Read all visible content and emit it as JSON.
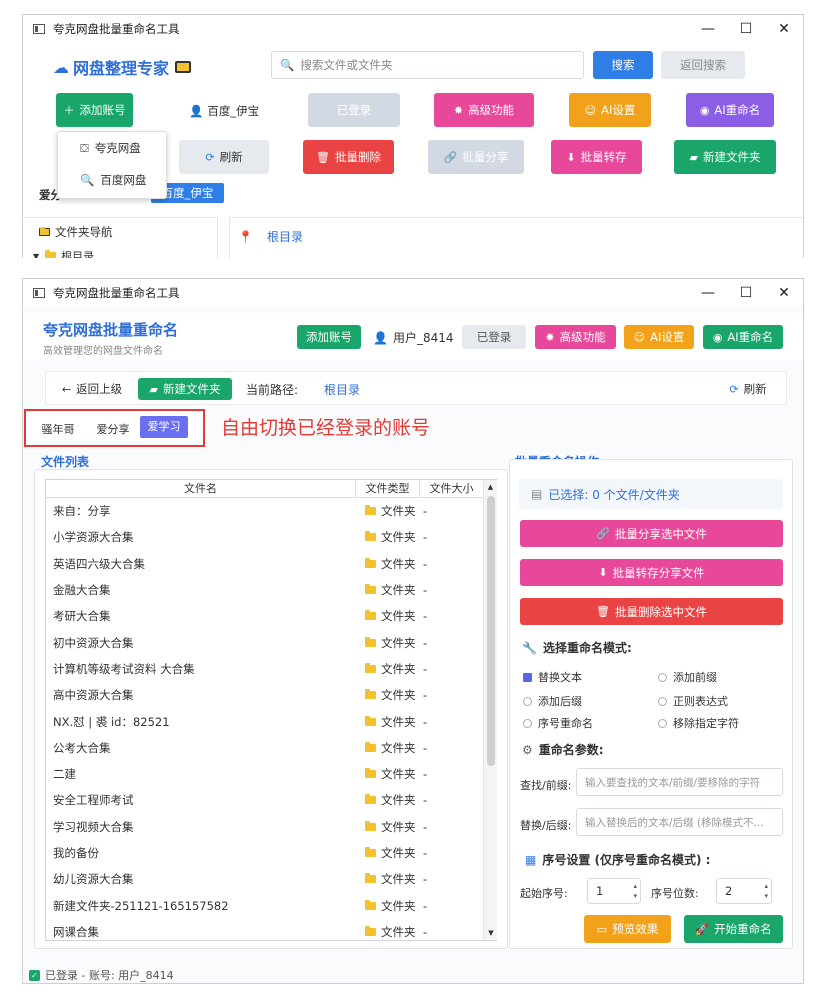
{
  "top_window": {
    "title": "夸克网盘批量重命名工具",
    "controls": [
      "—",
      "☐",
      "✕"
    ],
    "brand": "网盘整理专家",
    "search_placeholder": "搜索文件或文件夹",
    "search_btn": "搜索",
    "back_search_btn": "返回搜索",
    "add_account_btn": "添加账号",
    "user": "百度_伊宝",
    "logged_in_btn": "已登录",
    "advanced_btn": "高级功能",
    "ai_settings_btn": "AI设置",
    "ai_rename_btn": "AI重命名",
    "refresh_btn": "刷新",
    "batch_delete_btn": "批量删除",
    "batch_share_btn": "批量分享",
    "batch_save_btn": "批量转存",
    "new_folder_btn": "新建文件夹",
    "dropdown": [
      "夸克网盘",
      "百度网盘"
    ],
    "account_row_label": "爱分",
    "account_tag": "百度_伊宝",
    "nav_title": "文件夹导航",
    "tree_root": "根目录",
    "breadcrumb_root": "根目录"
  },
  "main_window": {
    "title": "夸克网盘批量重命名工具",
    "controls": [
      "—",
      "☐",
      "✕"
    ],
    "brand_title": "夸克网盘批量重命名",
    "brand_sub": "高效管理您的网盘文件命名",
    "add_account_btn": "添加账号",
    "user": "用户_8414",
    "logged_in_btn": "已登录",
    "advanced_btn": "高级功能",
    "ai_settings_btn": "AI设置",
    "ai_rename_btn": "AI重命名",
    "back_btn": "返回上级",
    "new_folder_btn": "新建文件夹",
    "path_label": "当前路径:",
    "path_value": "根目录",
    "refresh_btn": "刷新",
    "account_tabs": [
      "骚年哥",
      "爱分享",
      "爱学习"
    ],
    "annotation": "自由切换已经登录的账号",
    "file_list_title": "文件列表",
    "columns": [
      "文件名",
      "文件类型",
      "文件大小"
    ],
    "files": [
      {
        "name": "来自：分享",
        "type": "文件夹",
        "size": "-"
      },
      {
        "name": "小学资源大合集",
        "type": "文件夹",
        "size": "-"
      },
      {
        "name": "英语四六级大合集",
        "type": "文件夹",
        "size": "-"
      },
      {
        "name": "金融大合集",
        "type": "文件夹",
        "size": "-"
      },
      {
        "name": "考研大合集",
        "type": "文件夹",
        "size": "-"
      },
      {
        "name": "初中资源大合集",
        "type": "文件夹",
        "size": "-"
      },
      {
        "name": "计算机等级考试资料 大合集",
        "type": "文件夹",
        "size": "-"
      },
      {
        "name": "高中资源大合集",
        "type": "文件夹",
        "size": "-"
      },
      {
        "name": "NX.怼 | 裘 id：82521",
        "type": "文件夹",
        "size": "-"
      },
      {
        "name": "公考大合集",
        "type": "文件夹",
        "size": "-"
      },
      {
        "name": "二建",
        "type": "文件夹",
        "size": "-"
      },
      {
        "name": "安全工程师考试",
        "type": "文件夹",
        "size": "-"
      },
      {
        "name": "学习视频大合集",
        "type": "文件夹",
        "size": "-"
      },
      {
        "name": "我的备份",
        "type": "文件夹",
        "size": "-"
      },
      {
        "name": "幼儿资源大合集",
        "type": "文件夹",
        "size": "-"
      },
      {
        "name": "新建文件夹-251121-165157582",
        "type": "文件夹",
        "size": "-"
      },
      {
        "name": "网课合集",
        "type": "文件夹",
        "size": "-"
      }
    ],
    "batch_title": "批量重命名操作",
    "selected_text": "已选择: 0 个文件/文件夹",
    "batch_share_btn": "批量分享选中文件",
    "batch_save_btn": "批量转存分享文件",
    "batch_delete_btn": "批量删除选中文件",
    "mode_title": "选择重命名模式:",
    "modes": [
      "替换文本",
      "添加前缀",
      "添加后缀",
      "正则表达式",
      "序号重命名",
      "移除指定字符"
    ],
    "params_title": "重命名参数:",
    "find_label": "查找/前缀:",
    "find_placeholder": "输入要查找的文本/前缀/要移除的字符",
    "replace_label": "替换/后缀:",
    "replace_placeholder": "输入替换后的文本/后缀 (移除模式不...",
    "seq_title": "序号设置 (仅序号重命名模式) :",
    "start_label": "起始序号:",
    "start_value": "1",
    "digits_label": "序号位数:",
    "digits_value": "2",
    "preview_btn": "预览效果",
    "start_btn": "开始重命名",
    "status": "已登录 - 账号: 用户_8414"
  }
}
